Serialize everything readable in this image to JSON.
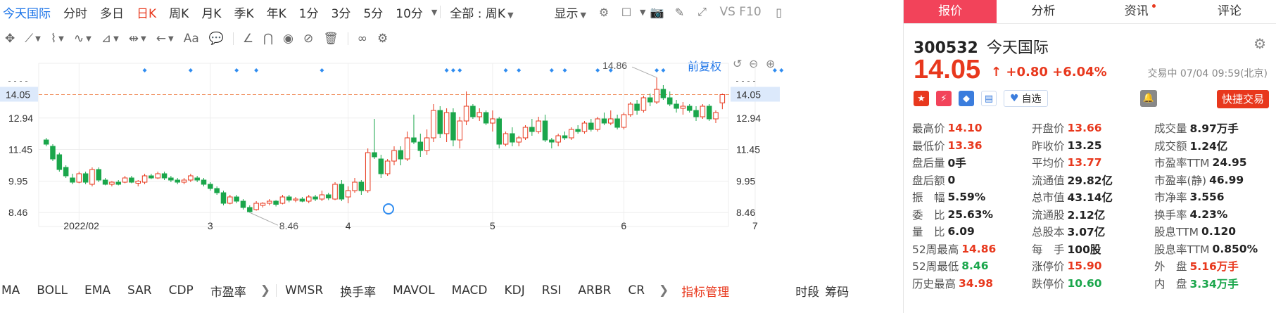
{
  "topbar": {
    "stock_label": "今天国际",
    "tabs": [
      "分时",
      "多日",
      "日K",
      "周K",
      "月K",
      "季K",
      "年K",
      "1分",
      "3分",
      "5分",
      "10分"
    ],
    "active_tab": "日K",
    "range_label": "全部 : 周K",
    "display_label": "显示",
    "vs_label": "VS F10"
  },
  "chart": {
    "fq_label": "前复权",
    "price_line_label": "14.05",
    "high_annotation": "14.86",
    "low_annotation": "8.46",
    "colors": {
      "up": "#e8381d",
      "down": "#1aa64b",
      "price_line": "#f08c5a",
      "grid": "#eeeeee",
      "marker": "#2f8cf0"
    }
  },
  "chart_data": {
    "type": "candlestick",
    "y_ticks": [
      8.46,
      9.95,
      11.45,
      12.94
    ],
    "current_price": 14.05,
    "ylim": [
      7.6,
      15.6
    ],
    "x_tick_labels": [
      "2022/02",
      "3",
      "4",
      "5",
      "6",
      "7"
    ],
    "period_high": 14.86,
    "period_low": 8.46,
    "candles": [
      {
        "o": 11.9,
        "h": 12.0,
        "l": 11.6,
        "c": 11.7
      },
      {
        "o": 11.6,
        "h": 11.7,
        "l": 10.9,
        "c": 11.0
      },
      {
        "o": 11.2,
        "h": 11.3,
        "l": 10.4,
        "c": 10.5
      },
      {
        "o": 10.6,
        "h": 10.7,
        "l": 10.1,
        "c": 10.2
      },
      {
        "o": 10.1,
        "h": 10.3,
        "l": 9.8,
        "c": 9.9
      },
      {
        "o": 9.9,
        "h": 10.4,
        "l": 9.85,
        "c": 10.3
      },
      {
        "o": 10.3,
        "h": 10.4,
        "l": 9.8,
        "c": 9.9
      },
      {
        "o": 9.8,
        "h": 10.6,
        "l": 9.7,
        "c": 10.5
      },
      {
        "o": 10.5,
        "h": 10.6,
        "l": 9.9,
        "c": 10.0
      },
      {
        "o": 10.0,
        "h": 10.1,
        "l": 9.75,
        "c": 9.8
      },
      {
        "o": 9.8,
        "h": 9.95,
        "l": 9.7,
        "c": 9.9
      },
      {
        "o": 9.9,
        "h": 10.0,
        "l": 9.75,
        "c": 9.8
      },
      {
        "o": 9.9,
        "h": 10.2,
        "l": 9.85,
        "c": 10.1
      },
      {
        "o": 10.1,
        "h": 10.2,
        "l": 9.85,
        "c": 9.9
      },
      {
        "o": 9.85,
        "h": 10.0,
        "l": 9.7,
        "c": 9.95
      },
      {
        "o": 9.9,
        "h": 10.3,
        "l": 9.8,
        "c": 10.2
      },
      {
        "o": 10.2,
        "h": 10.3,
        "l": 10.05,
        "c": 10.1
      },
      {
        "o": 10.1,
        "h": 10.4,
        "l": 10.05,
        "c": 10.3
      },
      {
        "o": 10.3,
        "h": 10.4,
        "l": 10.0,
        "c": 10.1
      },
      {
        "o": 10.1,
        "h": 10.2,
        "l": 9.9,
        "c": 10.0
      },
      {
        "o": 10.0,
        "h": 10.1,
        "l": 9.8,
        "c": 9.9
      },
      {
        "o": 9.9,
        "h": 10.1,
        "l": 9.8,
        "c": 10.0
      },
      {
        "o": 10.0,
        "h": 10.3,
        "l": 9.9,
        "c": 10.2
      },
      {
        "o": 10.1,
        "h": 10.2,
        "l": 9.9,
        "c": 10.0
      },
      {
        "o": 10.0,
        "h": 10.1,
        "l": 9.7,
        "c": 9.8
      },
      {
        "o": 9.8,
        "h": 9.9,
        "l": 9.5,
        "c": 9.6
      },
      {
        "o": 9.6,
        "h": 9.7,
        "l": 9.3,
        "c": 9.4
      },
      {
        "o": 9.4,
        "h": 9.5,
        "l": 8.8,
        "c": 8.9
      },
      {
        "o": 8.9,
        "h": 9.3,
        "l": 8.85,
        "c": 9.2
      },
      {
        "o": 9.2,
        "h": 9.3,
        "l": 8.9,
        "c": 9.0
      },
      {
        "o": 9.0,
        "h": 9.1,
        "l": 8.6,
        "c": 8.7
      },
      {
        "o": 8.7,
        "h": 8.8,
        "l": 8.46,
        "c": 8.5
      },
      {
        "o": 8.6,
        "h": 9.0,
        "l": 8.55,
        "c": 8.9
      },
      {
        "o": 8.8,
        "h": 8.95,
        "l": 8.7,
        "c": 8.9
      },
      {
        "o": 8.9,
        "h": 9.1,
        "l": 8.8,
        "c": 9.0
      },
      {
        "o": 9.0,
        "h": 9.05,
        "l": 8.75,
        "c": 8.85
      },
      {
        "o": 8.9,
        "h": 9.3,
        "l": 8.85,
        "c": 9.2
      },
      {
        "o": 9.2,
        "h": 9.3,
        "l": 8.95,
        "c": 9.05
      },
      {
        "o": 9.05,
        "h": 9.2,
        "l": 8.95,
        "c": 9.1
      },
      {
        "o": 9.1,
        "h": 9.2,
        "l": 8.95,
        "c": 9.0
      },
      {
        "o": 9.0,
        "h": 9.3,
        "l": 8.9,
        "c": 9.2
      },
      {
        "o": 9.2,
        "h": 9.3,
        "l": 9.0,
        "c": 9.1
      },
      {
        "o": 9.1,
        "h": 9.5,
        "l": 9.0,
        "c": 9.3
      },
      {
        "o": 9.3,
        "h": 9.4,
        "l": 9.05,
        "c": 9.15
      },
      {
        "o": 9.1,
        "h": 9.9,
        "l": 9.05,
        "c": 9.8
      },
      {
        "o": 9.8,
        "h": 10.0,
        "l": 9.0,
        "c": 9.1
      },
      {
        "o": 9.2,
        "h": 9.7,
        "l": 8.9,
        "c": 9.5
      },
      {
        "o": 9.5,
        "h": 10.1,
        "l": 9.4,
        "c": 9.9
      },
      {
        "o": 9.9,
        "h": 10.0,
        "l": 9.3,
        "c": 9.5
      },
      {
        "o": 9.5,
        "h": 11.5,
        "l": 9.4,
        "c": 11.3
      },
      {
        "o": 11.3,
        "h": 12.9,
        "l": 11.0,
        "c": 11.1
      },
      {
        "o": 11.0,
        "h": 11.2,
        "l": 10.1,
        "c": 10.3
      },
      {
        "o": 10.3,
        "h": 11.0,
        "l": 10.2,
        "c": 10.9
      },
      {
        "o": 10.9,
        "h": 11.6,
        "l": 10.7,
        "c": 11.4
      },
      {
        "o": 11.4,
        "h": 11.6,
        "l": 10.7,
        "c": 11.0
      },
      {
        "o": 11.0,
        "h": 12.3,
        "l": 10.9,
        "c": 12.0
      },
      {
        "o": 12.0,
        "h": 13.1,
        "l": 11.7,
        "c": 11.8
      },
      {
        "o": 11.8,
        "h": 12.2,
        "l": 11.1,
        "c": 11.4
      },
      {
        "o": 11.4,
        "h": 12.4,
        "l": 11.2,
        "c": 12.0
      },
      {
        "o": 12.0,
        "h": 13.6,
        "l": 11.8,
        "c": 13.3
      },
      {
        "o": 13.3,
        "h": 13.5,
        "l": 12.0,
        "c": 12.2
      },
      {
        "o": 12.2,
        "h": 13.4,
        "l": 11.8,
        "c": 13.2
      },
      {
        "o": 13.2,
        "h": 13.4,
        "l": 11.6,
        "c": 11.9
      },
      {
        "o": 11.9,
        "h": 13.0,
        "l": 11.5,
        "c": 12.8
      },
      {
        "o": 12.8,
        "h": 14.2,
        "l": 12.6,
        "c": 13.5
      },
      {
        "o": 13.5,
        "h": 13.6,
        "l": 12.9,
        "c": 13.0
      },
      {
        "o": 13.0,
        "h": 13.4,
        "l": 12.8,
        "c": 13.2
      },
      {
        "o": 13.2,
        "h": 13.3,
        "l": 12.6,
        "c": 12.7
      },
      {
        "o": 12.7,
        "h": 13.3,
        "l": 12.3,
        "c": 12.9
      },
      {
        "o": 12.9,
        "h": 13.0,
        "l": 11.5,
        "c": 11.7
      },
      {
        "o": 11.7,
        "h": 12.3,
        "l": 11.6,
        "c": 12.2
      },
      {
        "o": 12.2,
        "h": 12.5,
        "l": 11.6,
        "c": 11.8
      },
      {
        "o": 11.8,
        "h": 12.1,
        "l": 11.6,
        "c": 12.0
      },
      {
        "o": 12.0,
        "h": 12.6,
        "l": 11.9,
        "c": 12.5
      },
      {
        "o": 12.5,
        "h": 12.9,
        "l": 12.1,
        "c": 12.3
      },
      {
        "o": 12.3,
        "h": 13.0,
        "l": 12.2,
        "c": 12.8
      },
      {
        "o": 12.8,
        "h": 13.1,
        "l": 11.8,
        "c": 11.9
      },
      {
        "o": 11.9,
        "h": 12.0,
        "l": 11.5,
        "c": 11.8
      },
      {
        "o": 11.8,
        "h": 12.2,
        "l": 11.6,
        "c": 12.1
      },
      {
        "o": 12.1,
        "h": 12.3,
        "l": 11.9,
        "c": 12.0
      },
      {
        "o": 12.0,
        "h": 12.5,
        "l": 11.9,
        "c": 12.4
      },
      {
        "o": 12.4,
        "h": 12.6,
        "l": 12.2,
        "c": 12.3
      },
      {
        "o": 12.3,
        "h": 12.8,
        "l": 12.2,
        "c": 12.7
      },
      {
        "o": 12.7,
        "h": 12.9,
        "l": 12.3,
        "c": 12.4
      },
      {
        "o": 12.4,
        "h": 13.0,
        "l": 12.3,
        "c": 12.9
      },
      {
        "o": 12.9,
        "h": 13.2,
        "l": 12.6,
        "c": 12.7
      },
      {
        "o": 12.7,
        "h": 13.3,
        "l": 12.6,
        "c": 12.9
      },
      {
        "o": 12.9,
        "h": 13.1,
        "l": 12.4,
        "c": 12.5
      },
      {
        "o": 12.5,
        "h": 13.2,
        "l": 12.4,
        "c": 13.1
      },
      {
        "o": 13.1,
        "h": 13.7,
        "l": 13.0,
        "c": 13.6
      },
      {
        "o": 13.6,
        "h": 13.8,
        "l": 13.1,
        "c": 13.3
      },
      {
        "o": 13.3,
        "h": 14.0,
        "l": 13.2,
        "c": 13.9
      },
      {
        "o": 13.9,
        "h": 14.1,
        "l": 13.5,
        "c": 13.7
      },
      {
        "o": 13.7,
        "h": 14.86,
        "l": 13.6,
        "c": 14.3
      },
      {
        "o": 14.3,
        "h": 14.5,
        "l": 13.8,
        "c": 13.9
      },
      {
        "o": 13.9,
        "h": 14.2,
        "l": 13.5,
        "c": 13.6
      },
      {
        "o": 13.6,
        "h": 13.8,
        "l": 13.2,
        "c": 13.4
      },
      {
        "o": 13.4,
        "h": 13.7,
        "l": 13.1,
        "c": 13.5
      },
      {
        "o": 13.5,
        "h": 13.6,
        "l": 13.2,
        "c": 13.3
      },
      {
        "o": 13.3,
        "h": 13.5,
        "l": 12.8,
        "c": 13.0
      },
      {
        "o": 13.0,
        "h": 13.6,
        "l": 12.9,
        "c": 13.5
      },
      {
        "o": 13.5,
        "h": 13.6,
        "l": 12.8,
        "c": 12.9
      },
      {
        "o": 12.9,
        "h": 13.3,
        "l": 12.7,
        "c": 13.2
      },
      {
        "o": 13.66,
        "h": 14.1,
        "l": 13.36,
        "c": 14.05
      }
    ],
    "marker_positions": [
      15,
      22,
      29,
      32,
      42,
      61,
      62,
      63,
      70,
      72,
      77,
      79,
      84,
      86,
      93,
      94,
      111,
      112
    ]
  },
  "drawbar": {
    "aa_label": "Aa"
  },
  "indicators": {
    "items": [
      "MA",
      "BOLL",
      "EMA",
      "SAR",
      "CDP",
      "市盈率"
    ],
    "items2": [
      "WMSR",
      "换手率",
      "MAVOL",
      "MACD",
      "KDJ",
      "RSI",
      "ARBR",
      "CR"
    ],
    "manage_label": "指标管理",
    "right_items": [
      "时段",
      "筹码"
    ]
  },
  "panel": {
    "tabs": [
      "报价",
      "分析",
      "资讯",
      "评论"
    ],
    "code": "300532",
    "name": "今天国际",
    "price": "14.05",
    "change": "+0.80",
    "change_pct": "+6.04%",
    "status": "交易中 07/04 09:59(北京)",
    "zixuan_label": "自选",
    "quick_trade_label": "快捷交易",
    "quotes": [
      [
        {
          "l": "最高价",
          "v": "14.10",
          "c": "red"
        },
        {
          "l": "开盘价",
          "v": "13.66",
          "c": "red"
        },
        {
          "l": "成交量",
          "v": "8.97万手",
          "c": "dark"
        }
      ],
      [
        {
          "l": "最低价",
          "v": "13.36",
          "c": "red"
        },
        {
          "l": "昨收价",
          "v": "13.25",
          "c": "dark"
        },
        {
          "l": "成交额",
          "v": "1.24亿",
          "c": "dark"
        }
      ],
      [
        {
          "l": "盘后量",
          "v": "0手",
          "c": "dark"
        },
        {
          "l": "平均价",
          "v": "13.77",
          "c": "red"
        },
        {
          "l": "市盈率TTM",
          "v": "24.95",
          "c": "dark"
        }
      ],
      [
        {
          "l": "盘后额",
          "v": "0",
          "c": "dark"
        },
        {
          "l": "流通值",
          "v": "29.82亿",
          "c": "dark"
        },
        {
          "l": "市盈率(静)",
          "v": "46.99",
          "c": "dark"
        }
      ],
      [
        {
          "l": "振　幅",
          "v": "5.59%",
          "c": "dark"
        },
        {
          "l": "总市值",
          "v": "43.14亿",
          "c": "dark"
        },
        {
          "l": "市净率",
          "v": "3.556",
          "c": "dark"
        }
      ],
      [
        {
          "l": "委　比",
          "v": "25.63%",
          "c": "dark"
        },
        {
          "l": "流通股",
          "v": "2.12亿",
          "c": "dark"
        },
        {
          "l": "换手率",
          "v": "4.23%",
          "c": "dark"
        }
      ],
      [
        {
          "l": "量　比",
          "v": "6.09",
          "c": "dark"
        },
        {
          "l": "总股本",
          "v": "3.07亿",
          "c": "dark"
        },
        {
          "l": "股息TTM",
          "v": "0.120",
          "c": "dark"
        }
      ],
      [
        {
          "l": "52周最高",
          "v": "14.86",
          "c": "red"
        },
        {
          "l": "每　手",
          "v": "100股",
          "c": "dark"
        },
        {
          "l": "股息率TTM",
          "v": "0.850%",
          "c": "dark"
        }
      ],
      [
        {
          "l": "52周最低",
          "v": "8.46",
          "c": "green"
        },
        {
          "l": "涨停价",
          "v": "15.90",
          "c": "red"
        },
        {
          "l": "外　盘",
          "v": "5.16万手",
          "c": "red"
        }
      ],
      [
        {
          "l": "历史最高",
          "v": "34.98",
          "c": "red"
        },
        {
          "l": "跌停价",
          "v": "10.60",
          "c": "green"
        },
        {
          "l": "内　盘",
          "v": "3.34万手",
          "c": "green"
        }
      ]
    ]
  }
}
